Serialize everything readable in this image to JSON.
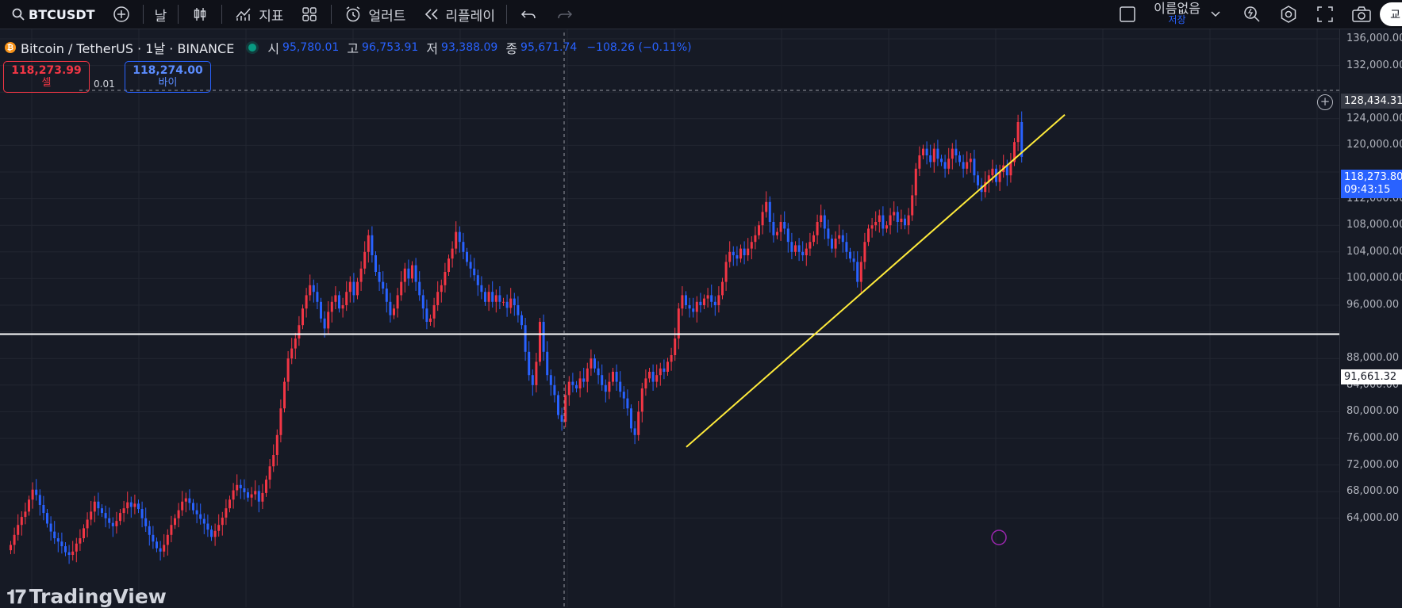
{
  "toolbar": {
    "symbol": "BTCUSDT",
    "interval": "날",
    "indicators": "지표",
    "alert": "얼러트",
    "replay": "리플레이",
    "layout_name": "이름없음",
    "layout_status": "저장",
    "publish_label": "교"
  },
  "legend": {
    "title": "Bitcoin / TetherUS · 1날 · BINANCE",
    "open_label": "시",
    "open": "95,780.01",
    "high_label": "고",
    "high": "96,753.91",
    "low_label": "저",
    "low": "93,388.09",
    "close_label": "종",
    "close": "95,671.74",
    "change": "−108.26 (−0.11%)"
  },
  "trade": {
    "sell_price": "118,273.99",
    "sell_label": "셀",
    "spread": "0.01",
    "buy_price": "118,274.00",
    "buy_label": "바이"
  },
  "price_axis": {
    "ticks": [
      "136,000.00",
      "132,000.00",
      "124,000.00",
      "120,000.00",
      "112,000.00",
      "108,000.00",
      "104,000.00",
      "100,000.00",
      "96,000.00",
      "88,000.00",
      "84,000.00",
      "80,000.00",
      "76,000.00",
      "72,000.00",
      "68,000.00",
      "64,000.00"
    ],
    "last_price": "118,273.80",
    "countdown": "09:43:15",
    "horizontal_line_price": "91,661.32",
    "crosshair_price": "128,434.31"
  },
  "watermark": "TradingView",
  "colors": {
    "up": "#f23645",
    "down": "#2962ff",
    "background": "#161a25",
    "trendline": "#ffeb3b",
    "hline": "#ffffff"
  },
  "chart_data": {
    "type": "candlestick",
    "x_start": 12,
    "x_step": 4.6,
    "closes": [
      60000,
      61500,
      63000,
      64200,
      65000,
      66800,
      68300,
      67500,
      66000,
      64800,
      63200,
      62000,
      61000,
      60500,
      59800,
      58900,
      58500,
      59000,
      60200,
      61000,
      62500,
      63800,
      65000,
      66500,
      65500,
      64800,
      64000,
      63300,
      62800,
      63600,
      64800,
      65500,
      66400,
      65700,
      66200,
      65400,
      64000,
      62800,
      61500,
      60500,
      59500,
      59000,
      60000,
      61500,
      63000,
      64000,
      65200,
      66500,
      67000,
      66300,
      65200,
      64600,
      63900,
      63200,
      62300,
      61200,
      62100,
      63000,
      64100,
      65500,
      66800,
      68200,
      69000,
      68500,
      67900,
      67100,
      67600,
      68100,
      66500,
      67800,
      69800,
      71800,
      73500,
      76500,
      80500,
      84500,
      88000,
      89500,
      91000,
      93000,
      95500,
      97500,
      99000,
      98000,
      96500,
      94000,
      92500,
      95000,
      96500,
      97500,
      95500,
      96000,
      98000,
      99500,
      97500,
      99500,
      101500,
      104000,
      106500,
      103500,
      101000,
      99500,
      98500,
      96500,
      94500,
      95500,
      97500,
      99500,
      101500,
      100000,
      102000,
      99500,
      97500,
      95500,
      93500,
      94000,
      96000,
      98000,
      99000,
      101000,
      103000,
      104500,
      107000,
      105500,
      104000,
      102500,
      101500,
      100500,
      99000,
      98000,
      96500,
      98000,
      96500,
      97500,
      96500,
      96500,
      95600,
      97000,
      96000,
      94500,
      93000,
      89000,
      85500,
      84000,
      87500,
      93500,
      89000,
      85500,
      84000,
      82500,
      79500,
      78500,
      82500,
      84500,
      84000,
      83500,
      85000,
      84500,
      86500,
      88000,
      86500,
      85500,
      84000,
      83000,
      84500,
      86000,
      84500,
      83000,
      82000,
      80500,
      77500,
      76500,
      80000,
      83500,
      85000,
      86000,
      84500,
      85500,
      86500,
      86000,
      87500,
      88500,
      91000,
      95500,
      97500,
      96000,
      95500,
      95000,
      96500,
      96000,
      97000,
      97500,
      96500,
      96000,
      97500,
      99500,
      102500,
      104000,
      103500,
      103000,
      104500,
      103500,
      104500,
      105500,
      106500,
      108000,
      110000,
      111500,
      108500,
      106500,
      107000,
      108500,
      107500,
      105500,
      104000,
      105000,
      104000,
      103500,
      104500,
      105500,
      106500,
      108500,
      109500,
      107500,
      106000,
      104500,
      106000,
      106500,
      105500,
      104000,
      103000,
      102500,
      99500,
      102500,
      105500,
      107500,
      108000,
      108500,
      109500,
      107500,
      108000,
      109500,
      110000,
      108500,
      109000,
      108000,
      109500,
      112500,
      116500,
      118500,
      119500,
      118500,
      117500,
      119500,
      118000,
      117500,
      116500,
      118000,
      119500,
      118500,
      117500,
      116500,
      117500,
      118000,
      115500,
      114000,
      113000,
      114500,
      115500,
      116500,
      114500,
      116000,
      117000,
      115500,
      117500,
      120500,
      123500,
      118273.8
    ],
    "ylim": [
      62000,
      138000
    ],
    "horizontal_line": 91661.32,
    "trendline": [
      {
        "x": 865,
        "price": 74700
      },
      {
        "x": 1342,
        "price": 124600
      }
    ]
  }
}
